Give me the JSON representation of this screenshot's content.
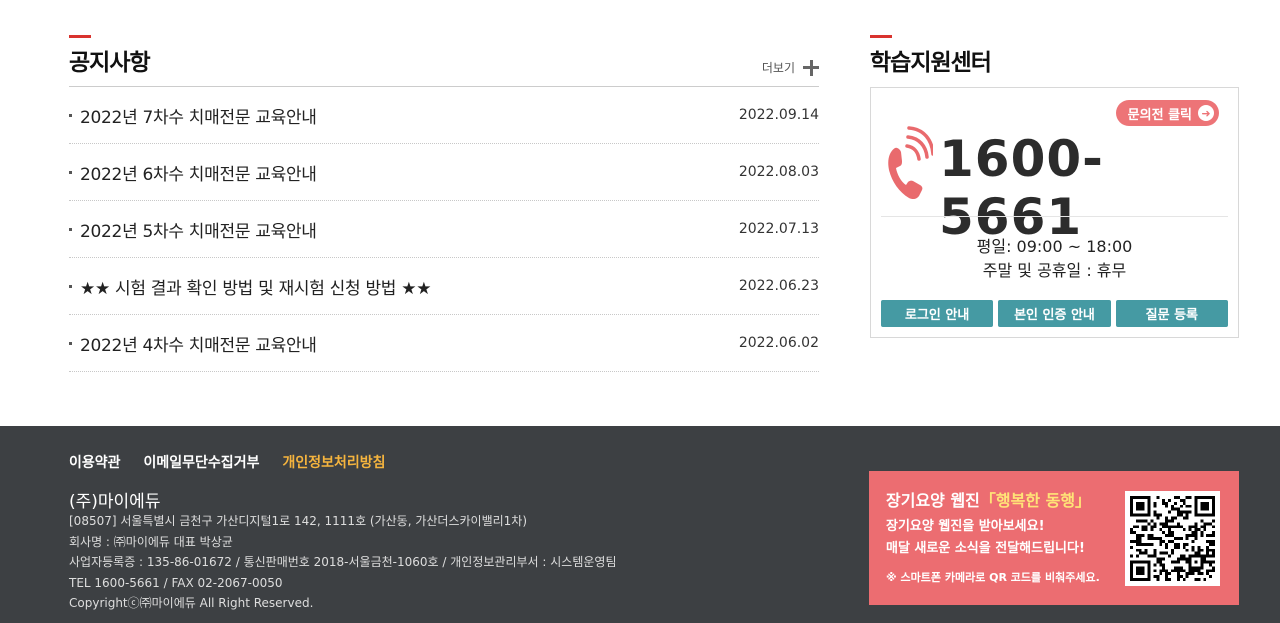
{
  "notice": {
    "title": "공지사항",
    "more_label": "더보기",
    "items": [
      {
        "title": "2022년 7차수 치매전문 교육안내",
        "date": "2022.09.14"
      },
      {
        "title": "2022년 6차수 치매전문 교육안내",
        "date": "2022.08.03"
      },
      {
        "title": "2022년 5차수 치매전문 교육안내",
        "date": "2022.07.13"
      },
      {
        "title": "★★ 시험 결과 확인 방법 및 재시험 신청 방법 ★★",
        "date": "2022.06.23"
      },
      {
        "title": "2022년 4차수 치매전문 교육안내",
        "date": "2022.06.02"
      }
    ]
  },
  "support": {
    "title": "학습지원센터",
    "chat_label": "문의전 클릭",
    "phone_number": "1600-5661",
    "hours_weekday": "평일: 09:00 ~ 18:00",
    "hours_weekend": "주말 및 공휴일 : 휴무",
    "buttons": [
      "로그인 안내",
      "본인 인증 안내",
      "질문 등록"
    ]
  },
  "footer": {
    "links": [
      "이용약관",
      "이메일무단수집거부",
      "개인정보처리방침"
    ],
    "company": "(주)마이에듀",
    "info": [
      "[08507] 서울특별시 금천구 가산디지털1로 142, 1111호 (가산동, 가산더스카이밸리1차)",
      "회사명 : ㈜마이에듀 대표 박상균",
      "사업자등록증 : 135-86-01672 / 통신판매번호 2018-서울금천-1060호 / 개인정보관리부서 : 시스템운영팀",
      "TEL 1600-5661 / FAX 02-2067-0050",
      "Copyrightⓒ㈜마이에듀 All Right Reserved."
    ],
    "banner": {
      "title_prefix": "장기요양 웹진",
      "title_highlight": "「행복한 동행」",
      "line1": "장기요양 웹진을 받아보세요!",
      "line2": "매달 새로운 소식을 전달해드립니다!",
      "note": "※ 스마트폰 카메라로 QR 코드를 비춰주세요."
    }
  },
  "colors": {
    "accent_red": "#d9332e",
    "teal": "#459aa3",
    "pink": "#ec6d71",
    "footer_bg": "#3d4043",
    "highlight": "#f5b43e"
  }
}
